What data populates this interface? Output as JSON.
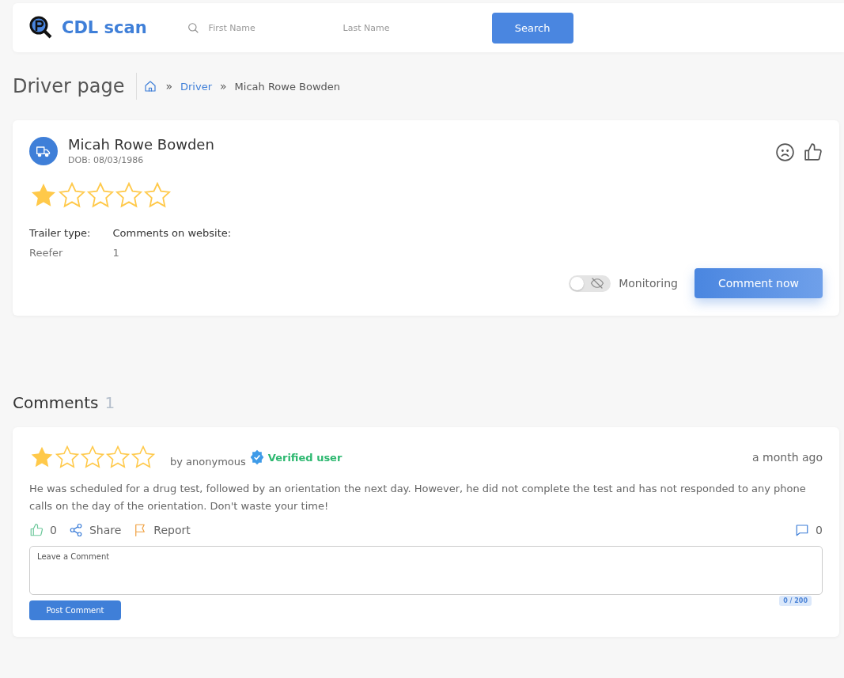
{
  "header": {
    "logo": "CDL scan",
    "first_name": {
      "placeholder": "First Name"
    },
    "last_name": {
      "placeholder": "Last Name"
    },
    "search_button": "Search"
  },
  "page_title": "Driver page",
  "breadcrumb": [
    {
      "separator": "»",
      "label": "Driver",
      "link": true
    },
    {
      "separator": "»",
      "label": "Micah Rowe Bowden",
      "link": false
    }
  ],
  "driver": {
    "name": "Micah Rowe Bowden",
    "dob": "DOB: 08/03/1986",
    "stars": 1,
    "fields": [
      {
        "label": "Trailer type:",
        "value": "Reefer"
      },
      {
        "label": "Comments on website:",
        "value": "1"
      }
    ],
    "monitoring": {
      "label": "Monitoring",
      "on": false
    },
    "comment_button": "Comment now"
  },
  "comments_title": "Comments",
  "comments_count": "1",
  "comments": [
    {
      "stars": 1,
      "author": "by anonymous",
      "badge": "Verified user",
      "time": "a month ago",
      "text": "He was scheduled for a drug test, followed by an orientation the next day. However, he did not complete the test and has not responded to any phone calls on the day of the orientation. Don't waste your time!",
      "likes": "0",
      "share": "Share",
      "report": "Report",
      "replies": "0",
      "reply_field": {
        "placeholder": "Leave a Comment",
        "counter": "0 / 200"
      },
      "post_button": "Post Comment"
    }
  ]
}
